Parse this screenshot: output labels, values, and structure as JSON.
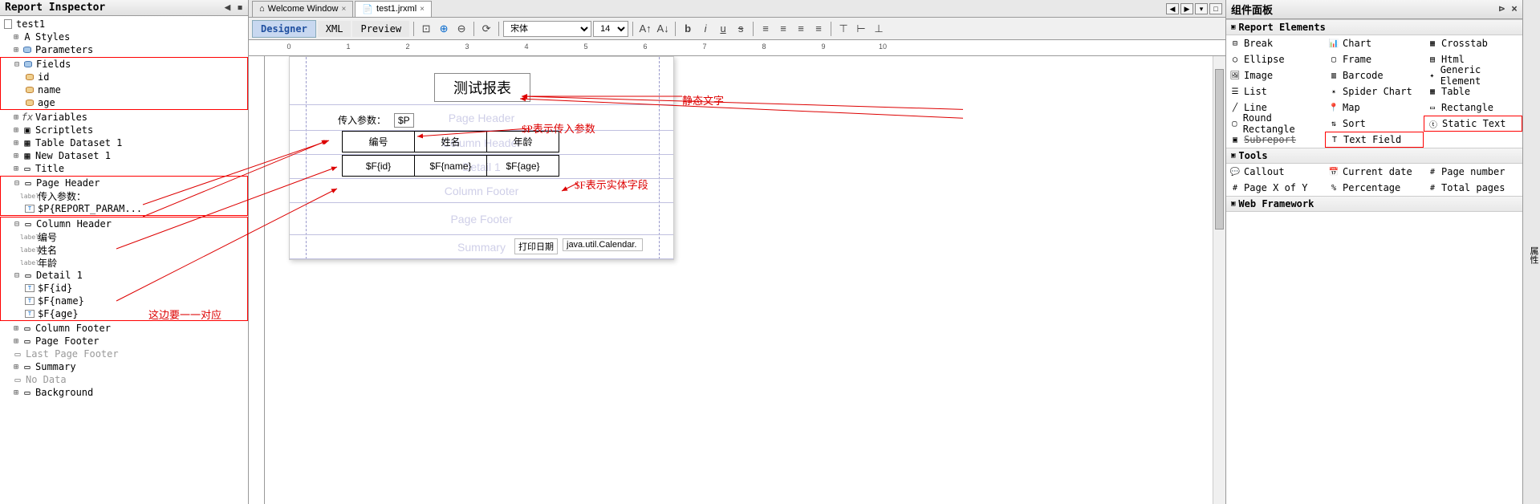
{
  "left_panel": {
    "title": "Report Inspector",
    "root": "test1",
    "nodes": {
      "styles": "Styles",
      "parameters": "Parameters",
      "fields": "Fields",
      "field_id": "id",
      "field_name": "name",
      "field_age": "age",
      "variables": "Variables",
      "scriptlets": "Scriptlets",
      "table_dataset": "Table Dataset 1",
      "new_dataset": "New Dataset 1",
      "title_band": "Title",
      "page_header": "Page Header",
      "ph_label": "传入参数：",
      "ph_param": "$P{REPORT_PARAM...",
      "column_header": "Column Header",
      "ch1": "编号",
      "ch2": "姓名",
      "ch3": "年龄",
      "detail": "Detail 1",
      "d1": "$F{id}",
      "d2": "$F{name}",
      "d3": "$F{age}",
      "column_footer": "Column Footer",
      "page_footer": "Page Footer",
      "last_page_footer": "Last Page Footer",
      "summary": "Summary",
      "no_data": "No Data",
      "background": "Background"
    }
  },
  "tabs": {
    "welcome": "Welcome Window",
    "file": "test1.jrxml"
  },
  "toolbar": {
    "designer": "Designer",
    "xml": "XML",
    "preview": "Preview",
    "font": "宋体",
    "size": "14"
  },
  "canvas": {
    "ruler_inches": [
      "0",
      "1",
      "2",
      "3",
      "4",
      "5",
      "6",
      "7",
      "8",
      "9",
      "10",
      "11"
    ],
    "title_text": "测试报表",
    "param_label": "传入参数：",
    "param_value": "$P",
    "headers": [
      "编号",
      "姓名",
      "年龄"
    ],
    "fields": [
      "$F{id}",
      "$F{name}",
      "$F{age}"
    ],
    "bands": {
      "page_header": "Page Header",
      "column_header": "Column Header",
      "detail": "Detail 1",
      "column_footer": "Column Footer",
      "page_footer": "Page Footer",
      "summary": "Summary"
    },
    "print_label": "打印日期",
    "print_value": "java.util.Calendar."
  },
  "annotations": {
    "static_text": "静态文字",
    "p_desc": "$P表示传入参数",
    "f_desc": "$F表示实体字段",
    "corresp": "这边要一一对应"
  },
  "right_panel": {
    "title": "组件面板",
    "side_tab": "属性",
    "sections": {
      "report_elements": "Report Elements",
      "tools": "Tools",
      "web_framework": "Web Framework"
    },
    "elements": {
      "break": "Break",
      "chart": "Chart",
      "crosstab": "Crosstab",
      "ellipse": "Ellipse",
      "frame": "Frame",
      "html": "Html",
      "image": "Image",
      "barcode": "Barcode",
      "generic": "Generic Element",
      "list": "List",
      "spider": "Spider Chart",
      "table": "Table",
      "line": "Line",
      "map": "Map",
      "rectangle": "Rectangle",
      "round_rect": "Round Rectangle",
      "sort": "Sort",
      "static_text": "Static Text",
      "subreport": "Subreport",
      "text_field": "Text Field"
    },
    "tools": {
      "callout": "Callout",
      "current_date": "Current date",
      "page_number": "Page number",
      "page_xy": "Page X of Y",
      "percentage": "Percentage",
      "total_pages": "Total pages"
    }
  }
}
